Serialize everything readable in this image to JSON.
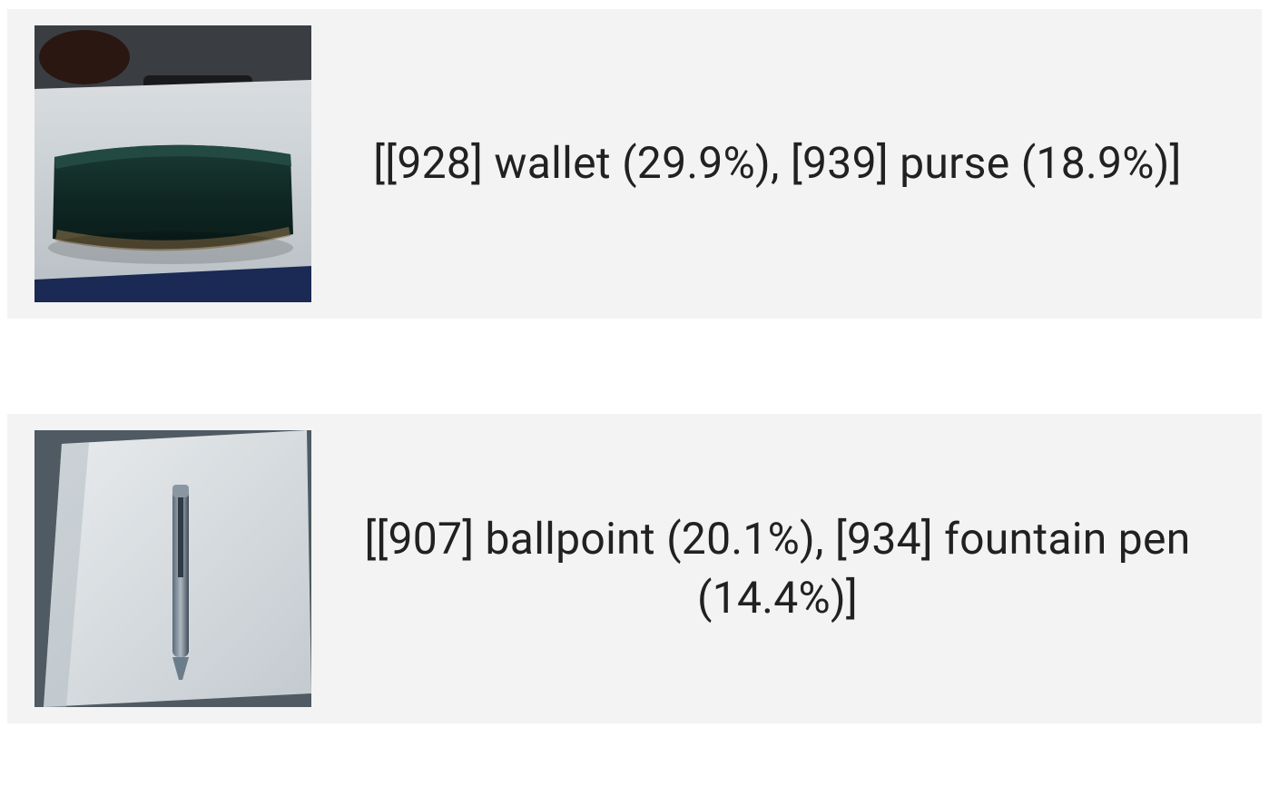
{
  "results": [
    {
      "thumb": "wallet",
      "predictions": "[[928] wallet (29.9%), [939] purse (18.9%)]"
    },
    {
      "thumb": "pen",
      "predictions": "[[907] ballpoint (20.1%), [934] fountain pen (14.4%)]"
    }
  ]
}
